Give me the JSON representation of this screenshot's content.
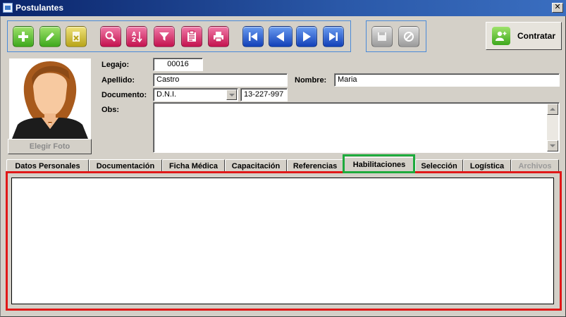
{
  "window": {
    "title": "Postulantes",
    "close_glyph": "✕"
  },
  "toolbar": {
    "buttons": [
      {
        "name": "add-icon",
        "color": "#3da81c"
      },
      {
        "name": "edit-pencil-icon",
        "color": "#3da81c"
      },
      {
        "name": "delete-document-icon",
        "color": "#b8a418"
      },
      {
        "name": "search-magnifier-icon",
        "color": "#c4124e"
      },
      {
        "name": "sort-az-icon",
        "color": "#c4124e"
      },
      {
        "name": "filter-funnel-icon",
        "color": "#c4124e"
      },
      {
        "name": "report-clipboard-icon",
        "color": "#c4124e"
      },
      {
        "name": "print-icon",
        "color": "#c4124e"
      },
      {
        "name": "first-record-icon",
        "color": "#1240b8"
      },
      {
        "name": "previous-record-icon",
        "color": "#1240b8"
      },
      {
        "name": "next-record-icon",
        "color": "#1240b8"
      },
      {
        "name": "last-record-icon",
        "color": "#1240b8"
      },
      {
        "name": "save-icon",
        "color": "#9a9a9a"
      },
      {
        "name": "cancel-icon",
        "color": "#9a9a9a"
      }
    ],
    "contratar_label": "Contratar"
  },
  "photo": {
    "button_label": "Elegir Foto"
  },
  "form": {
    "legajo_label": "Legajo:",
    "legajo_value": "00016",
    "apellido_label": "Apellido:",
    "apellido_value": "Castro",
    "nombre_label": "Nombre:",
    "nombre_value": "Maria",
    "documento_label": "Documento:",
    "documento_type": "D.N.I.",
    "documento_number": "13-227-997",
    "obs_label": "Obs:"
  },
  "tabs": [
    {
      "label": "Datos Personales"
    },
    {
      "label": "Documentación"
    },
    {
      "label": "Ficha Médica"
    },
    {
      "label": "Capacitación"
    },
    {
      "label": "Referencias"
    },
    {
      "label": "Habilitaciones"
    },
    {
      "label": "Selección"
    },
    {
      "label": "Logística"
    },
    {
      "label": "Archivos"
    }
  ],
  "active_tab": "Habilitaciones",
  "colors": {
    "highlight_tab": "#1eaa3c",
    "highlight_panel": "#e01818",
    "titlebar": "#0a246a"
  }
}
